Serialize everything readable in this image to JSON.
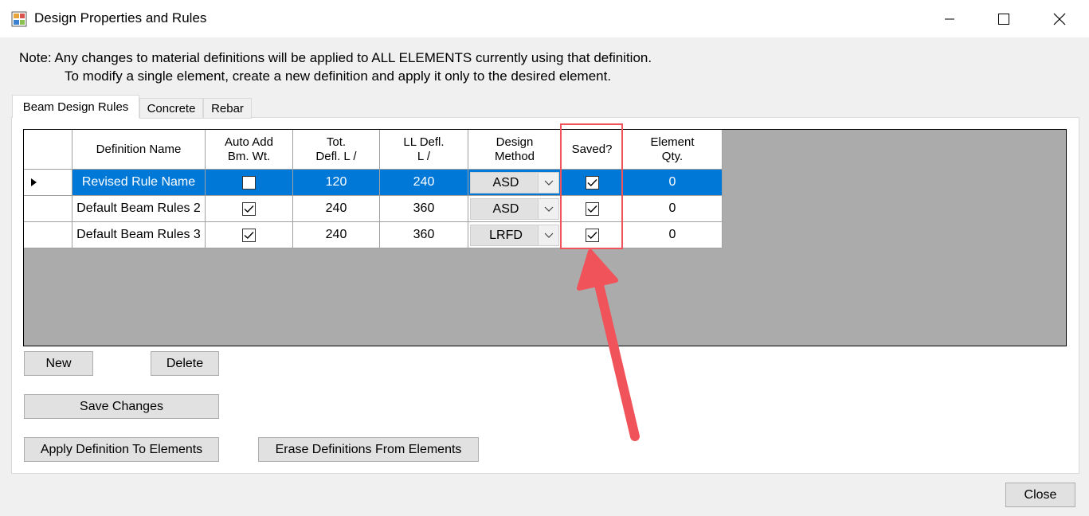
{
  "window": {
    "title": "Design Properties and Rules",
    "minimize_icon": "minimize-icon",
    "maximize_icon": "maximize-icon",
    "close_icon": "close-icon"
  },
  "note": {
    "line1": "Note:  Any changes to material definitions will be applied to ALL ELEMENTS currently using that definition.",
    "line2": "To modify a single element, create a new definition and apply it only to the desired element."
  },
  "tabs": [
    {
      "label": "Beam Design Rules",
      "active": true
    },
    {
      "label": "Concrete",
      "active": false
    },
    {
      "label": "Rebar",
      "active": false
    }
  ],
  "grid": {
    "headers": {
      "definition_name": "Definition Name",
      "auto_add_l1": "Auto Add",
      "auto_add_l2": "Bm. Wt.",
      "tot_defl_l1": "Tot.",
      "tot_defl_l2": "Defl. L /",
      "ll_defl_l1": "LL Defl.",
      "ll_defl_l2": "L /",
      "design_method_l1": "Design",
      "design_method_l2": "Method",
      "saved": "Saved?",
      "element_qty_l1": "Element",
      "element_qty_l2": "Qty."
    },
    "rows": [
      {
        "name": "Revised Rule Name",
        "auto_add": false,
        "tot_defl": "120",
        "ll_defl": "240",
        "method": "ASD",
        "saved": true,
        "qty": "0",
        "selected": true
      },
      {
        "name": "Default Beam Rules 2",
        "auto_add": true,
        "tot_defl": "240",
        "ll_defl": "360",
        "method": "ASD",
        "saved": true,
        "qty": "0",
        "selected": false
      },
      {
        "name": "Default Beam Rules 3",
        "auto_add": true,
        "tot_defl": "240",
        "ll_defl": "360",
        "method": "LRFD",
        "saved": true,
        "qty": "0",
        "selected": false
      }
    ]
  },
  "buttons": {
    "new": "New",
    "delete": "Delete",
    "save_changes": "Save Changes",
    "apply": "Apply Definition To Elements",
    "erase": "Erase Definitions From Elements",
    "close": "Close"
  },
  "colors": {
    "selection": "#0078d7",
    "annotation": "#f0535a",
    "grid_background": "#ababab"
  }
}
